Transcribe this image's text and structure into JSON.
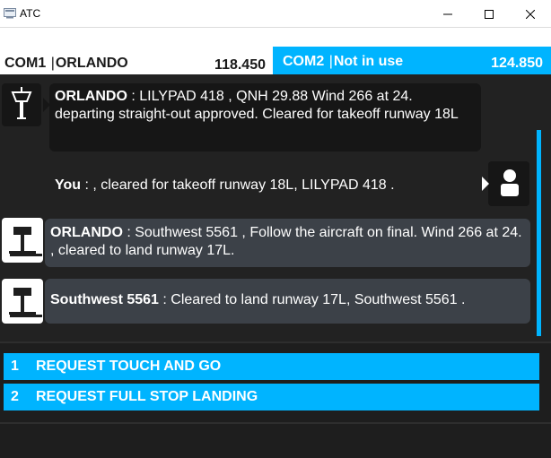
{
  "window": {
    "title": "ATC",
    "icons": [
      "window-app-icon",
      "minimize-icon",
      "maximize-icon",
      "close-icon"
    ]
  },
  "com1": {
    "label": "COM1",
    "station": "ORLANDO",
    "frequency": "118.450"
  },
  "com2": {
    "label": "COM2",
    "station": "Not in use",
    "frequency": "124.850"
  },
  "messages": [
    {
      "speaker": "ORLANDO",
      "text": " : LILYPAD 418 , QNH 29.88 Wind 266 at 24. departing straight-out approved. Cleared for takeoff runway 18L",
      "icon": "control-tower-icon"
    },
    {
      "speaker": "You",
      "text": " : , cleared for takeoff runway 18L, LILYPAD 418 .",
      "icon": "user-icon"
    },
    {
      "speaker": "ORLANDO",
      "text": " : Southwest 5561 , Follow the aircraft on final. Wind 266 at 24. , cleared to land runway 17L.",
      "icon": "control-tower-icon"
    },
    {
      "speaker": "Southwest 5561",
      "text": " : Cleared to land runway 17L, Southwest 5561 .",
      "icon": "control-tower-icon"
    }
  ],
  "requests": [
    {
      "number": "1",
      "label": "REQUEST TOUCH AND GO"
    },
    {
      "number": "2",
      "label": "REQUEST FULL STOP LANDING"
    }
  ],
  "colors": {
    "accent": "#00b4ff",
    "background": "#1e1e1e",
    "bubble_grey": "#3c4148"
  }
}
